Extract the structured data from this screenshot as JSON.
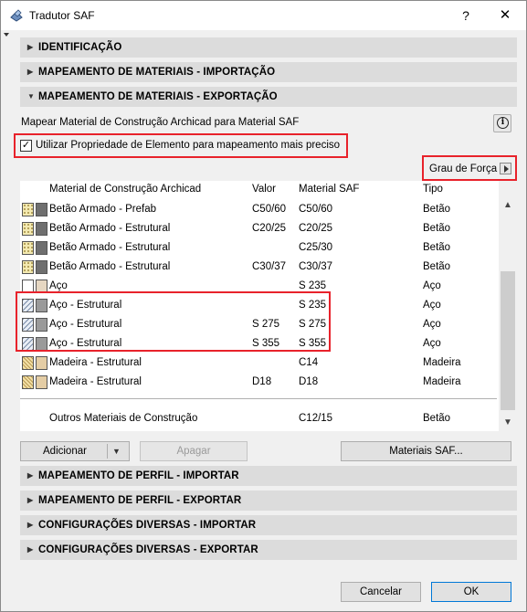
{
  "window": {
    "title": "Tradutor SAF",
    "help_label": "?",
    "close_label": "✕"
  },
  "sections_top": [
    {
      "label": "IDENTIFICAÇÃO",
      "expanded": false
    },
    {
      "label": "MAPEAMENTO DE MATERIAIS - IMPORTAÇÃO",
      "expanded": false
    },
    {
      "label": "MAPEAMENTO DE MATERIAIS - EXPORTAÇÃO",
      "expanded": true
    }
  ],
  "export_panel": {
    "description": "Mapear Material de Construção Archicad para Material SAF",
    "info_icon": "i",
    "checkbox": {
      "checked": true,
      "label": "Utilizar Propriedade de Elemento para mapeamento mais preciso"
    },
    "grau_label": "Grau de Força",
    "columns": [
      "Material de Construção Archicad",
      "Valor",
      "Material SAF",
      "Tipo"
    ],
    "rows": [
      {
        "material": "Betão Armado - Prefab",
        "valor": "C50/60",
        "saf": "C50/60",
        "tipo": "Betão",
        "swatch": "concrete"
      },
      {
        "material": "Betão Armado - Estrutural",
        "valor": "C20/25",
        "saf": "C20/25",
        "tipo": "Betão",
        "swatch": "concrete"
      },
      {
        "material": "Betão Armado - Estrutural",
        "valor": "",
        "saf": "C25/30",
        "tipo": "Betão",
        "swatch": "concrete"
      },
      {
        "material": "Betão Armado - Estrutural",
        "valor": "C30/37",
        "saf": "C30/37",
        "tipo": "Betão",
        "swatch": "concrete"
      },
      {
        "material": "Aço",
        "valor": "",
        "saf": "S 235",
        "tipo": "Aço",
        "swatch": "steel-plain"
      },
      {
        "material": "Aço - Estrutural",
        "valor": "",
        "saf": "S 235",
        "tipo": "Aço",
        "swatch": "steel"
      },
      {
        "material": "Aço - Estrutural",
        "valor": "S 275",
        "saf": "S 275",
        "tipo": "Aço",
        "swatch": "steel"
      },
      {
        "material": "Aço - Estrutural",
        "valor": "S 355",
        "saf": "S 355",
        "tipo": "Aço",
        "swatch": "steel"
      },
      {
        "material": "Madeira - Estrutural",
        "valor": "",
        "saf": "C14",
        "tipo": "Madeira",
        "swatch": "wood"
      },
      {
        "material": "Madeira - Estrutural",
        "valor": "D18",
        "saf": "D18",
        "tipo": "Madeira",
        "swatch": "wood"
      }
    ],
    "other_row": {
      "material": "Outros Materiais de Construção",
      "saf": "C12/15",
      "tipo": "Betão"
    },
    "buttons": {
      "add": "Adicionar",
      "delete": "Apagar",
      "saf_materials": "Materiais SAF..."
    }
  },
  "sections_bottom": [
    {
      "label": "MAPEAMENTO DE PERFIL - IMPORTAR"
    },
    {
      "label": "MAPEAMENTO DE PERFIL - EXPORTAR"
    },
    {
      "label": "CONFIGURAÇÕES DIVERSAS - IMPORTAR"
    },
    {
      "label": "CONFIGURAÇÕES DIVERSAS - EXPORTAR"
    }
  ],
  "footer": {
    "cancel": "Cancelar",
    "ok": "OK"
  },
  "colors": {
    "highlight_red": "#e8222b",
    "section_bg": "#dcdcdc",
    "dialog_bg": "#f0f0f0"
  }
}
